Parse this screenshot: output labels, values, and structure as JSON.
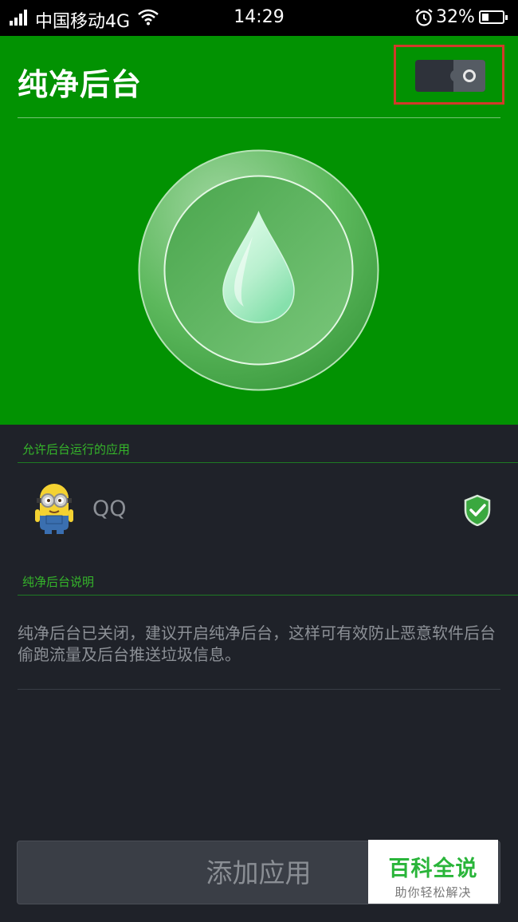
{
  "status_bar": {
    "carrier": "中国移动4G",
    "time": "14:29",
    "battery_percent": "32%",
    "battery_level": 0.32,
    "icons": [
      "signal-icon",
      "wifi-icon",
      "alarm-icon",
      "battery-icon"
    ]
  },
  "header": {
    "title": "纯净后台",
    "toggle_state": "off",
    "bg_color": "#029202"
  },
  "allowed_apps": {
    "section_label": "允许后台运行的应用",
    "items": [
      {
        "name": "QQ",
        "icon": "minion-app-icon",
        "status_icon": "shield-check-icon"
      }
    ]
  },
  "explanation": {
    "section_label": "纯净后台说明",
    "text": "纯净后台已关闭，建议开启纯净后台，这样可有效防止恶意软件后台偷跑流量及后台推送垃圾信息。"
  },
  "add_button": {
    "label": "添加应用"
  },
  "watermark": {
    "main": "百科全说",
    "sub": "助你轻松解决"
  },
  "colors": {
    "accent": "#029202",
    "section_label": "#35b52a",
    "background": "#1f2229"
  }
}
